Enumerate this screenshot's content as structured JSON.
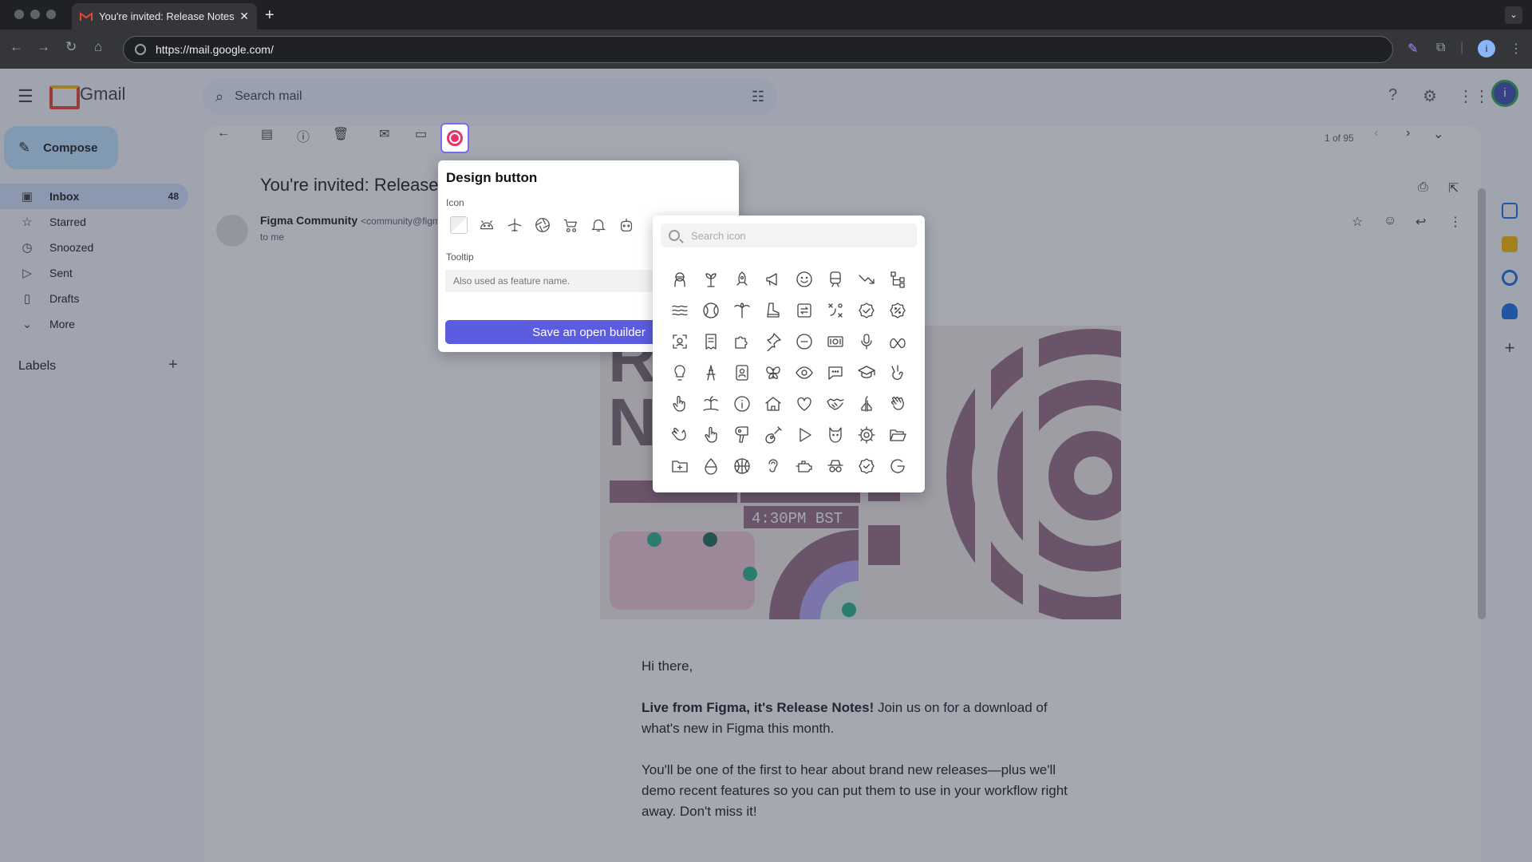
{
  "browser": {
    "tab_title": "You're invited: Release Notes",
    "url": "https://mail.google.com/",
    "profile_initial": "i"
  },
  "gmail": {
    "app_name": "Gmail",
    "search_placeholder": "Search mail",
    "compose_label": "Compose",
    "nav": [
      {
        "label": "Inbox",
        "count": "48",
        "icon": "inbox-icon"
      },
      {
        "label": "Starred",
        "count": "",
        "icon": "star-icon"
      },
      {
        "label": "Snoozed",
        "count": "",
        "icon": "clock-icon"
      },
      {
        "label": "Sent",
        "count": "",
        "icon": "send-icon"
      },
      {
        "label": "Drafts",
        "count": "",
        "icon": "draft-icon"
      },
      {
        "label": "More",
        "count": "",
        "icon": "chevron-down-icon"
      }
    ],
    "labels_heading": "Labels",
    "pager": "1 of 95",
    "avatar_initial": "i"
  },
  "email": {
    "subject": "You're invited: Release",
    "sender_name": "Figma Community",
    "sender_email": "<community@figm",
    "to": "to me",
    "greeting": "Hi there,",
    "para1_bold": "Live from Figma, it's Release Notes!",
    "para1_rest": " Join us on for a download of what's new in Figma this month.",
    "para2": "You'll be one of the first to hear about brand new releases—plus we'll demo recent features so you can put them to use in your workflow right away. Don't miss it!",
    "hero_time": "4:30PM  BST"
  },
  "design_panel": {
    "title": "Design button",
    "icon_label": "Icon",
    "tooltip_label": "Tooltip",
    "tooltip_placeholder": "Also used as feature name.",
    "save_label": "Save an open builder",
    "row_icons": [
      "empty-icon",
      "android-icon",
      "airplane-icon",
      "aperture-icon",
      "baby-carriage-icon",
      "bell-icon",
      "robot-icon"
    ]
  },
  "icon_picker": {
    "search_placeholder": "Search icon",
    "icons": [
      "astronaut-icon",
      "plant-icon",
      "rocket-icon",
      "megaphone-icon",
      "smile-icon",
      "train-icon",
      "trend-down-icon",
      "hierarchy-icon",
      "waves-icon",
      "tennis-ball-icon",
      "palm-tree-icon",
      "boot-icon",
      "swap-icon",
      "strategy-icon",
      "badge-check-icon",
      "discount-icon",
      "scan-face-icon",
      "receipt-icon",
      "puzzle-icon",
      "pin-icon",
      "minus-circle-icon",
      "cash-icon",
      "microphone-icon",
      "meta-icon",
      "bulb-icon",
      "tower-icon",
      "contact-book-icon",
      "butterfly-icon",
      "eye-icon",
      "chat-icon",
      "graduation-cap-icon",
      "victory-hand-icon",
      "hand-up-icon",
      "island-icon",
      "info-circle-icon",
      "home-icon",
      "heart-icon",
      "handshake-icon",
      "pray-icon",
      "wave-hand-icon",
      "clap-icon",
      "pointer-hand-icon",
      "hair-dryer-icon",
      "guitar-icon",
      "play-icon",
      "cat-icon",
      "gear-icon",
      "folder-open-icon",
      "folder-plus-icon",
      "drop-icon",
      "basketball-icon",
      "ear-icon",
      "engine-icon",
      "incognito-icon",
      "verified-icon",
      "google-icon"
    ]
  },
  "colors": {
    "accent": "#5b5cdf",
    "record": "#e8326a",
    "hero_mauve": "#9a6f86",
    "hero_green": "#2bb38c"
  }
}
